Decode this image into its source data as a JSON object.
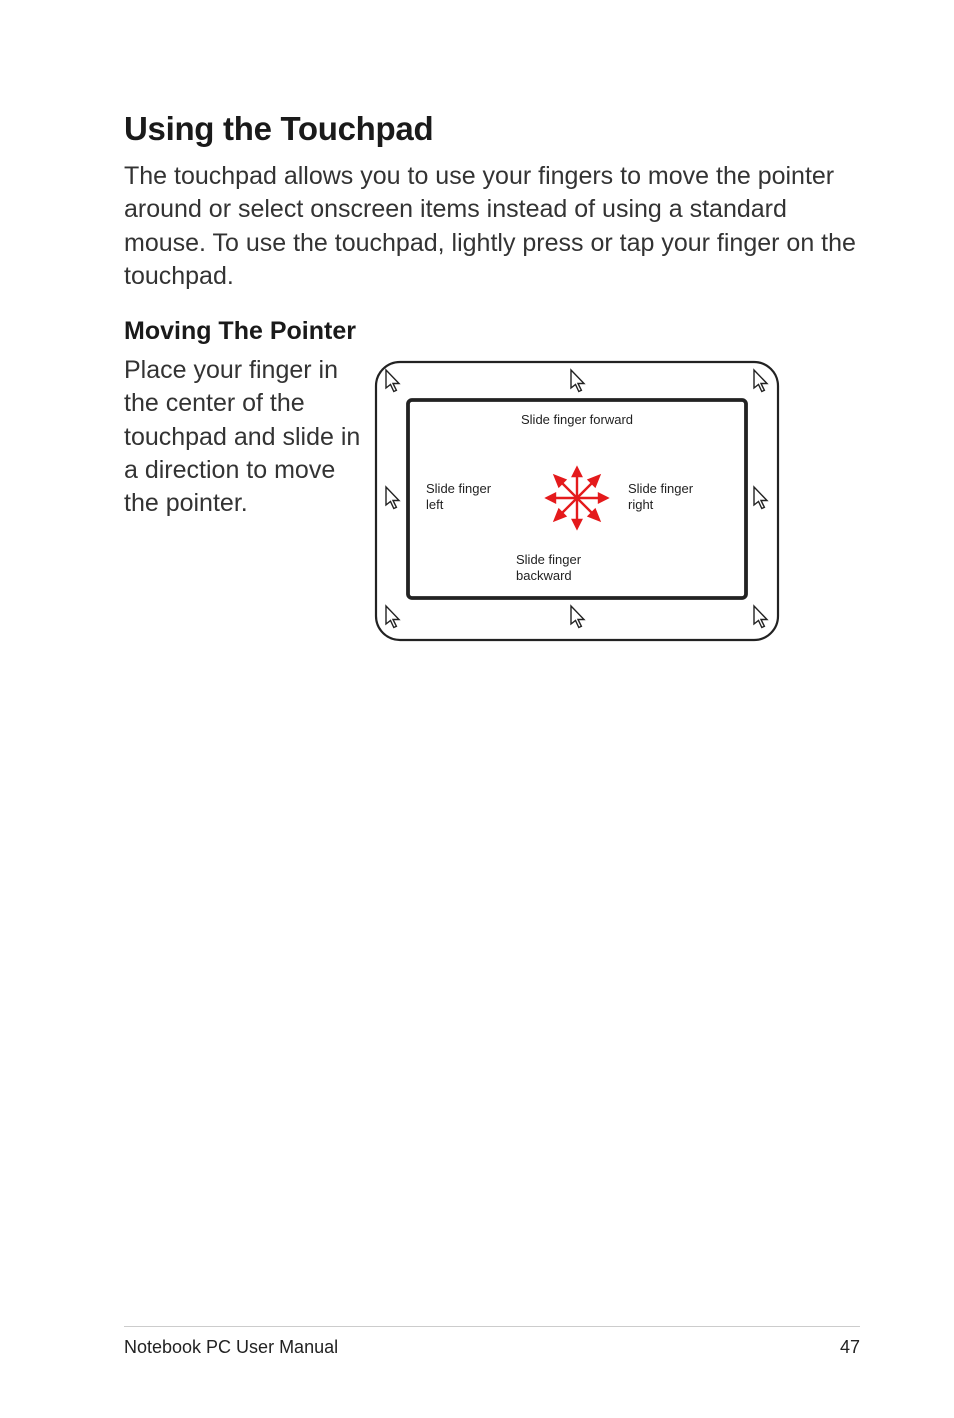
{
  "heading": "Using the Touchpad",
  "intro": "The touchpad allows you to use your fingers to move the pointer around or select onscreen items instead of using a standard mouse. To use the touchpad, lightly press or tap your finger on the touchpad.",
  "subheading": "Moving The Pointer",
  "pointer_text": "Place your finger in the center of the touchpad and slide in a direction to move the pointer.",
  "diagram": {
    "label_forward": "Slide finger forward",
    "label_left_1": "Slide finger",
    "label_left_2": "left",
    "label_right_1": "Slide finger",
    "label_right_2": "right",
    "label_back_1": "Slide finger",
    "label_back_2": "backward"
  },
  "footer": {
    "left": "Notebook PC User Manual",
    "right": "47"
  }
}
